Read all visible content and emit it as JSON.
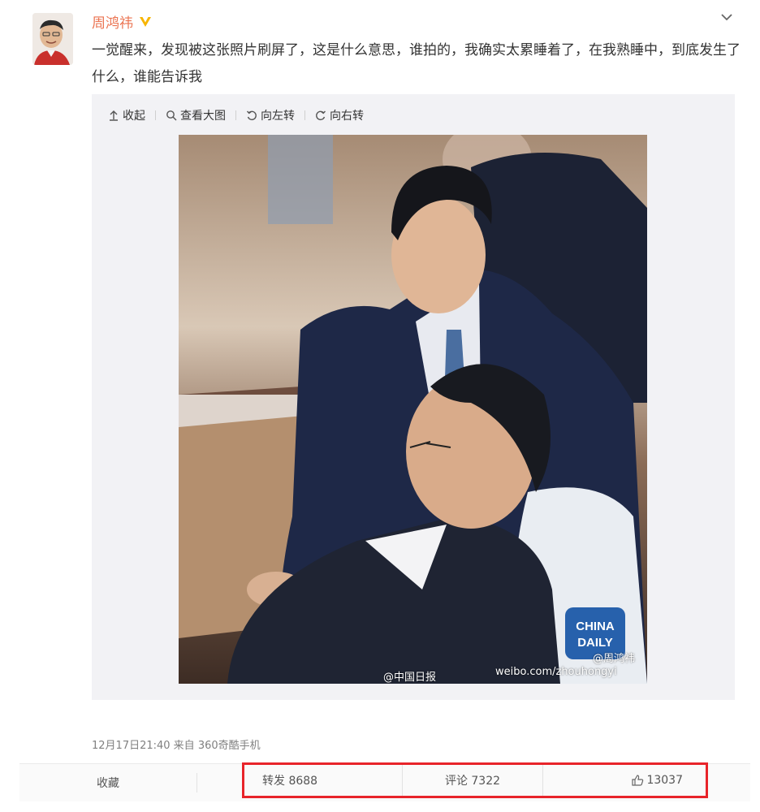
{
  "post": {
    "username": "周鸿祎",
    "text": "一觉醒来，发现被这张照片刷屏了，这是什么意思，谁拍的，我确实太累睡着了，在我熟睡中，到底发生了什么，谁能告诉我",
    "meta": "12月17日21:40 来自 360奇酷手机"
  },
  "toolbar": {
    "collapse": "收起",
    "view_large": "查看大图",
    "rotate_left": "向左转",
    "rotate_right": "向右转"
  },
  "photo_watermarks": {
    "logo": "CHINA DAILY",
    "logo_line1": "CHINA",
    "logo_line2": "DAILY",
    "brand": "@中国日报",
    "url": "weibo.com/zhouhongyi",
    "handle": "@周鸿祎"
  },
  "actions": {
    "favorite": "收藏",
    "repost": "转发 8688",
    "comment": "评论 7322",
    "like": "13037"
  },
  "icons": [
    "verified-icon",
    "chevron-down-icon",
    "collapse-icon",
    "search-icon",
    "rotate-left-icon",
    "rotate-right-icon",
    "thumb-up-icon"
  ],
  "colors": {
    "username": "#eb7350",
    "verified": "#f7b500",
    "highlight_box": "#e8242a"
  }
}
